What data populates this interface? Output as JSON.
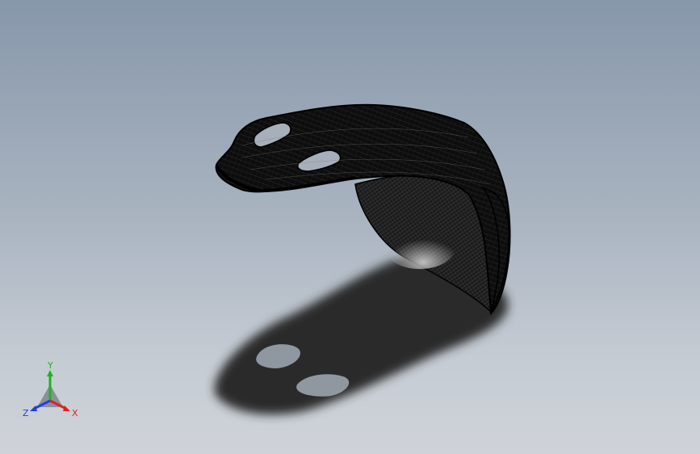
{
  "viewport": {
    "background_top": "#8797aa",
    "background_bottom": "#cfd3d9"
  },
  "model": {
    "display_style": "wireframe",
    "color": "#111111",
    "shadow": true
  },
  "triad": {
    "x_label": "X",
    "y_label": "Y",
    "z_label": "Z",
    "x_color": "#e02020",
    "y_color": "#22b022",
    "z_color": "#2040e0"
  }
}
